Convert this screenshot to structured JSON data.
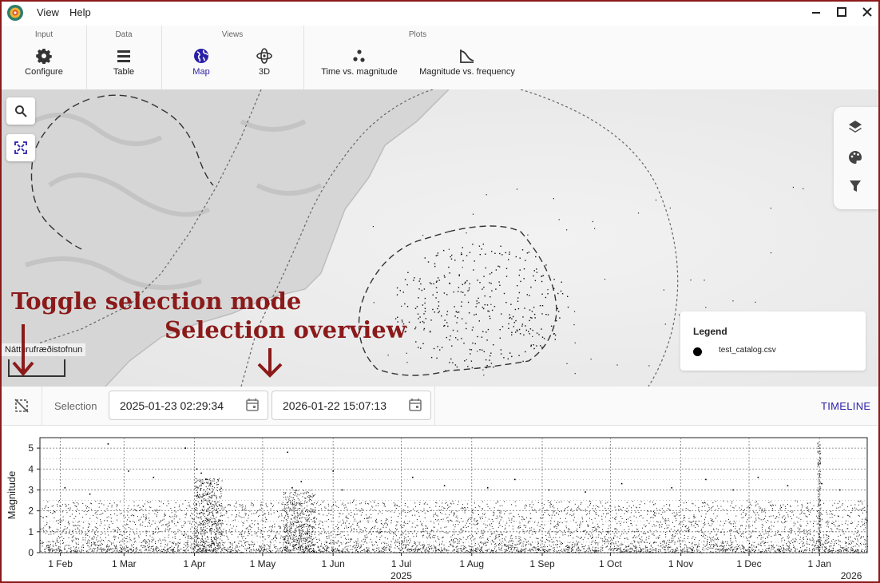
{
  "menu": {
    "view": "View",
    "help": "Help"
  },
  "window_controls": {
    "minimize": "—",
    "maximize": "☐",
    "close": "✕"
  },
  "ribbon": {
    "groups": {
      "input": "Input",
      "data": "Data",
      "views": "Views",
      "plots": "Plots"
    },
    "configure": "Configure",
    "table": "Table",
    "map": "Map",
    "three_d": "3D",
    "time_vs_magnitude": "Time vs. magnitude",
    "magnitude_vs_frequency": "Magnitude vs. frequency"
  },
  "map": {
    "legend_title": "Legend",
    "legend_item": "test_catalog.csv",
    "attribution": "Náttúrufræðistofnun"
  },
  "annotations": {
    "toggle_selection_mode": "Toggle selection mode",
    "selection_overview": "Selection overview"
  },
  "selection": {
    "label": "Selection",
    "start": "2025-01-23 02:29:34",
    "end": "2026-01-22 15:07:13",
    "timeline_button": "TIMELINE"
  },
  "colors": {
    "accent": "#2a1fa8",
    "annotation": "#8b1a1a"
  },
  "chart_data": {
    "type": "scatter",
    "title": "",
    "xlabel": "",
    "ylabel": "Magnitude",
    "x_range": [
      "2025-01-23",
      "2026-01-22"
    ],
    "ylim": [
      0,
      5.5
    ],
    "y_ticks": [
      0,
      1,
      2,
      3,
      4,
      5
    ],
    "x_ticks": [
      "1 Feb",
      "1 Mar",
      "1 Apr",
      "1 May",
      "1 Jun",
      "1 Jul",
      "1 Aug",
      "1 Sep",
      "1 Oct",
      "1 Nov",
      "1 Dec",
      "1 Jan"
    ],
    "x_tick_dates": [
      "2025-02-01",
      "2025-03-01",
      "2025-04-01",
      "2025-05-01",
      "2025-06-01",
      "2025-07-01",
      "2025-08-01",
      "2025-09-01",
      "2025-10-01",
      "2025-11-01",
      "2025-12-01",
      "2026-01-01"
    ],
    "year_labels": [
      {
        "text": "2025",
        "date": "2025-07-01"
      },
      {
        "text": "2026",
        "date": "2026-01-15"
      }
    ],
    "grid": true,
    "points": [
      {
        "x": "2025-02-03",
        "y": 3.1
      },
      {
        "x": "2025-02-14",
        "y": 2.8
      },
      {
        "x": "2025-02-22",
        "y": 5.2
      },
      {
        "x": "2025-03-03",
        "y": 3.9
      },
      {
        "x": "2025-03-14",
        "y": 3.6
      },
      {
        "x": "2025-03-28",
        "y": 5.0
      },
      {
        "x": "2025-04-02",
        "y": 4.0
      },
      {
        "x": "2025-04-04",
        "y": 3.8
      },
      {
        "x": "2025-04-06",
        "y": 3.5
      },
      {
        "x": "2025-04-08",
        "y": 3.3
      },
      {
        "x": "2025-05-12",
        "y": 4.8
      },
      {
        "x": "2025-05-14",
        "y": 3.1
      },
      {
        "x": "2025-05-18",
        "y": 3.4
      },
      {
        "x": "2025-06-01",
        "y": 3.9
      },
      {
        "x": "2025-06-05",
        "y": 3.0
      },
      {
        "x": "2025-07-06",
        "y": 3.6
      },
      {
        "x": "2025-07-20",
        "y": 3.2
      },
      {
        "x": "2025-08-08",
        "y": 3.1
      },
      {
        "x": "2025-08-20",
        "y": 3.5
      },
      {
        "x": "2025-09-04",
        "y": 3.0
      },
      {
        "x": "2025-09-20",
        "y": 2.9
      },
      {
        "x": "2025-10-06",
        "y": 3.3
      },
      {
        "x": "2025-10-28",
        "y": 3.1
      },
      {
        "x": "2025-11-12",
        "y": 3.5
      },
      {
        "x": "2025-11-24",
        "y": 3.0
      },
      {
        "x": "2025-12-05",
        "y": 3.6
      },
      {
        "x": "2025-12-18",
        "y": 3.2
      },
      {
        "x": "2026-01-02",
        "y": 3.3
      },
      {
        "x": "2026-01-10",
        "y": 3.0
      }
    ]
  }
}
